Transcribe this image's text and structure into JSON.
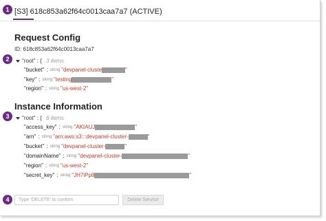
{
  "header": {
    "title": "[S3] 618c853a62f64c0013caa7a7 (ACTIVE)"
  },
  "annotations": [
    "1",
    "2",
    "3",
    "4"
  ],
  "request_config": {
    "title": "Request Config",
    "id_line": "ID: 618c853a62f64c0013caa7a7",
    "root_label": "\"root\"",
    "root_bracket": ": {",
    "count": "3 items",
    "rows": [
      {
        "key": "\"bucket\"",
        "type": "string",
        "value": "\"devpanel-cluste"
      },
      {
        "key": "\"key\"",
        "type": "string",
        "value": "\"testing"
      },
      {
        "key": "\"region\"",
        "type": "string",
        "value": "\"us-west-2\""
      }
    ]
  },
  "instance_information": {
    "title": "Instance Information",
    "root_label": "\"root\"",
    "root_bracket": ": {",
    "count": "6 items",
    "rows": [
      {
        "key": "\"access_key\"",
        "type": "string",
        "value": "\"AKIAUJ"
      },
      {
        "key": "\"arn\"",
        "type": "string",
        "value": "\"arn:aws:s3:::devpanel-cluster-"
      },
      {
        "key": "\"bucket\"",
        "type": "string",
        "value": "\"devpanel-cluster-"
      },
      {
        "key": "\"domainName\"",
        "type": "string",
        "value": "\"devpanel-cluster-"
      },
      {
        "key": "\"region\"",
        "type": "string",
        "value": "\"us-west-2\""
      },
      {
        "key": "\"secret_key\"",
        "type": "string",
        "value": "\"JH7iPp8"
      }
    ]
  },
  "footer": {
    "confirm_placeholder": "Type 'DELETE' to confirm",
    "delete_label": "Delete Service"
  },
  "colors": {
    "badge": "#6b2a84",
    "value_text": "#c0392b"
  }
}
